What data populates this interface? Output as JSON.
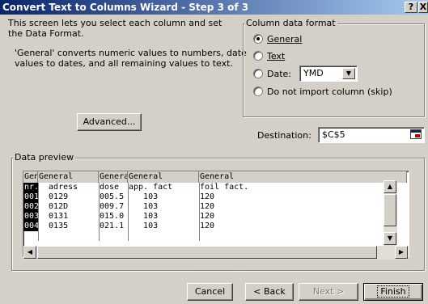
{
  "window": {
    "title": "Convert Text to Columns Wizard - Step 3 of 3",
    "help_btn": "?",
    "close_btn": "X"
  },
  "intro": {
    "line1": "This screen lets you select each column and set",
    "line2": "the Data Format.",
    "line3": "'General' converts numeric values to numbers, date",
    "line4": "values to dates, and all remaining values to text."
  },
  "advanced_button": {
    "label": "Advanced..."
  },
  "column_format": {
    "legend": "Column data format",
    "options": [
      {
        "label": "General",
        "selected": true
      },
      {
        "label": "Text",
        "selected": false
      },
      {
        "label": "Date:",
        "selected": false
      },
      {
        "label": "Do not import column (skip)",
        "selected": false
      }
    ],
    "date_value": "YMD"
  },
  "destination": {
    "label": "Destination:",
    "value": "$C$5"
  },
  "preview": {
    "legend": "Data preview",
    "columns": [
      {
        "header": "General",
        "rows": [
          "nr.",
          "001",
          "002",
          "003",
          "004"
        ]
      },
      {
        "header": "General",
        "rows": [
          "  adress",
          "  0129",
          "  012D",
          "  0131",
          "  0135"
        ]
      },
      {
        "header": "General",
        "rows": [
          "dose",
          "005.5",
          "009.7",
          "015.0",
          "021.1"
        ]
      },
      {
        "header": "General",
        "rows": [
          "app. fact",
          "   103",
          "   103",
          "   103",
          "   103"
        ]
      },
      {
        "header": "General",
        "rows": [
          "foil fact.",
          "120",
          "120",
          "120",
          "120"
        ]
      }
    ]
  },
  "buttons": {
    "cancel": "Cancel",
    "back": "< Back",
    "next": "Next >",
    "finish": "Finish"
  },
  "colors": {
    "title_start": "#0a246a",
    "title_end": "#a6caf0",
    "face": "#d4d0c8",
    "selected_col": "#000000"
  }
}
